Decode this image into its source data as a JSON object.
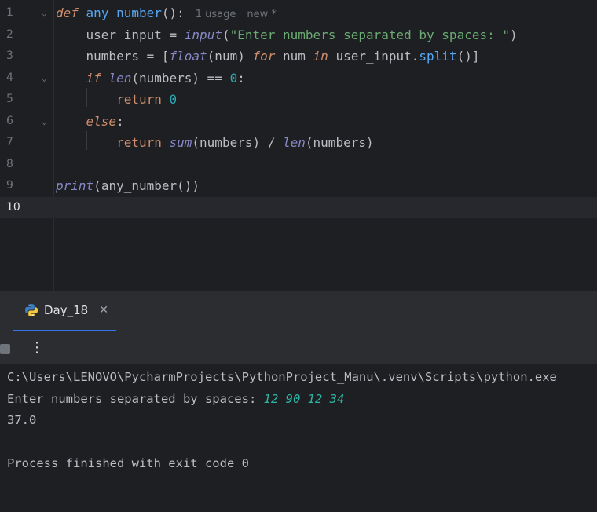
{
  "editor": {
    "lines": [
      {
        "no": "1",
        "segments": [
          {
            "t": "def",
            "c": "def"
          },
          {
            "t": " ",
            "c": ""
          },
          {
            "t": "any_number",
            "c": "nm"
          },
          {
            "t": "():",
            "c": ""
          }
        ],
        "hint_usage": "1 usage",
        "hint_new": "new *",
        "fold": "⌄"
      },
      {
        "no": "2",
        "segments": [
          {
            "t": "    user_input = ",
            "c": ""
          },
          {
            "t": "input",
            "c": "bii"
          },
          {
            "t": "(",
            "c": ""
          },
          {
            "t": "\"Enter numbers separated by spaces: \"",
            "c": "str"
          },
          {
            "t": ")",
            "c": ""
          }
        ]
      },
      {
        "no": "3",
        "segments": [
          {
            "t": "    numbers = [",
            "c": ""
          },
          {
            "t": "float",
            "c": "bii"
          },
          {
            "t": "(num) ",
            "c": ""
          },
          {
            "t": "for",
            "c": "kwi"
          },
          {
            "t": " num ",
            "c": ""
          },
          {
            "t": "in",
            "c": "kwi"
          },
          {
            "t": " user_input.",
            "c": ""
          },
          {
            "t": "split",
            "c": "fn"
          },
          {
            "t": "()]",
            "c": ""
          }
        ]
      },
      {
        "no": "4",
        "segments": [
          {
            "t": "    ",
            "c": ""
          },
          {
            "t": "if",
            "c": "kwi"
          },
          {
            "t": " ",
            "c": ""
          },
          {
            "t": "len",
            "c": "bii"
          },
          {
            "t": "(numbers) == ",
            "c": ""
          },
          {
            "t": "0",
            "c": "num"
          },
          {
            "t": ":",
            "c": ""
          }
        ],
        "fold": "⌄"
      },
      {
        "no": "5",
        "segments": [
          {
            "t": "        ",
            "c": ""
          },
          {
            "t": "return",
            "c": "kw"
          },
          {
            "t": " ",
            "c": ""
          },
          {
            "t": "0",
            "c": "num"
          }
        ]
      },
      {
        "no": "6",
        "segments": [
          {
            "t": "    ",
            "c": ""
          },
          {
            "t": "else",
            "c": "kwi"
          },
          {
            "t": ":",
            "c": ""
          }
        ],
        "fold": "⌄"
      },
      {
        "no": "7",
        "segments": [
          {
            "t": "        ",
            "c": ""
          },
          {
            "t": "return",
            "c": "kw"
          },
          {
            "t": " ",
            "c": ""
          },
          {
            "t": "sum",
            "c": "bii"
          },
          {
            "t": "(numbers) / ",
            "c": ""
          },
          {
            "t": "len",
            "c": "bii"
          },
          {
            "t": "(numbers)",
            "c": ""
          }
        ]
      },
      {
        "no": "8",
        "segments": []
      },
      {
        "no": "9",
        "segments": [
          {
            "t": "print",
            "c": "bii"
          },
          {
            "t": "(",
            "c": ""
          },
          {
            "t": "any_number",
            "c": ""
          },
          {
            "t": "())",
            "c": ""
          }
        ]
      },
      {
        "no": "10",
        "segments": [],
        "current": true
      }
    ]
  },
  "run_panel": {
    "tab_label": "Day_18",
    "close_glyph": "✕",
    "more_glyph": "⋮"
  },
  "console": {
    "command": "C:\\Users\\LENOVO\\PycharmProjects\\PythonProject_Manu\\.venv\\Scripts\\python.exe",
    "prompt": "Enter numbers separated by spaces: ",
    "user_input": "12 90 12 34",
    "result": "37.0",
    "exit_message": "Process finished with exit code 0"
  },
  "colors": {
    "background": "#1e1f22",
    "panel": "#2b2d30",
    "accent": "#3574f0",
    "keyword": "#cf8e6d",
    "string": "#6aab73",
    "number": "#2aacb8",
    "builtin": "#8888c6",
    "function": "#56a8f5"
  }
}
